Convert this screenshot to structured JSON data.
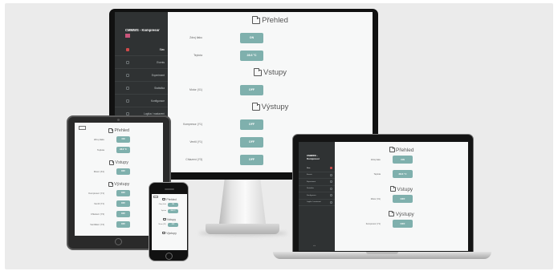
{
  "app": {
    "title": "CMMWS - Kompresor",
    "title_line1": "CMMWS -",
    "title_line2": "Kompresor"
  },
  "nav": [
    {
      "label": "Stav",
      "active": true
    },
    {
      "label": "Events",
      "active": false
    },
    {
      "label": "Experiment",
      "active": false
    },
    {
      "label": "Statistika",
      "active": false
    },
    {
      "label": "Konfigurace",
      "active": false
    },
    {
      "label": "Logika / nastavení",
      "active": false
    }
  ],
  "sections": {
    "prehled": "Přehled",
    "vstupy": "Vstupy",
    "vystupy": "Výstupy"
  },
  "prehled_rows": [
    {
      "label": "Zdroj tlaku",
      "value": "ON"
    },
    {
      "label": "Teplota",
      "value": "28.6 °C"
    }
  ],
  "vstupy_rows": [
    {
      "label": "Motor (X1)",
      "value": "OFF"
    }
  ],
  "vystupy_rows": [
    {
      "label": "Kompresor (Y1)",
      "value": "OFF"
    },
    {
      "label": "Ventil (Y1)",
      "value": "OFF"
    },
    {
      "label": "Chlazení (Y3)",
      "value": "OFF"
    },
    {
      "label": "Ventilátor (Y4)",
      "value": "OFF"
    }
  ],
  "laptop_pager": "◂ ▸",
  "colors": {
    "sidebar": "#2f3233",
    "content": "#f7f8f8",
    "button": "#7fb0ad",
    "active_indicator": "#d04a4a",
    "background": "#ebebeb"
  }
}
